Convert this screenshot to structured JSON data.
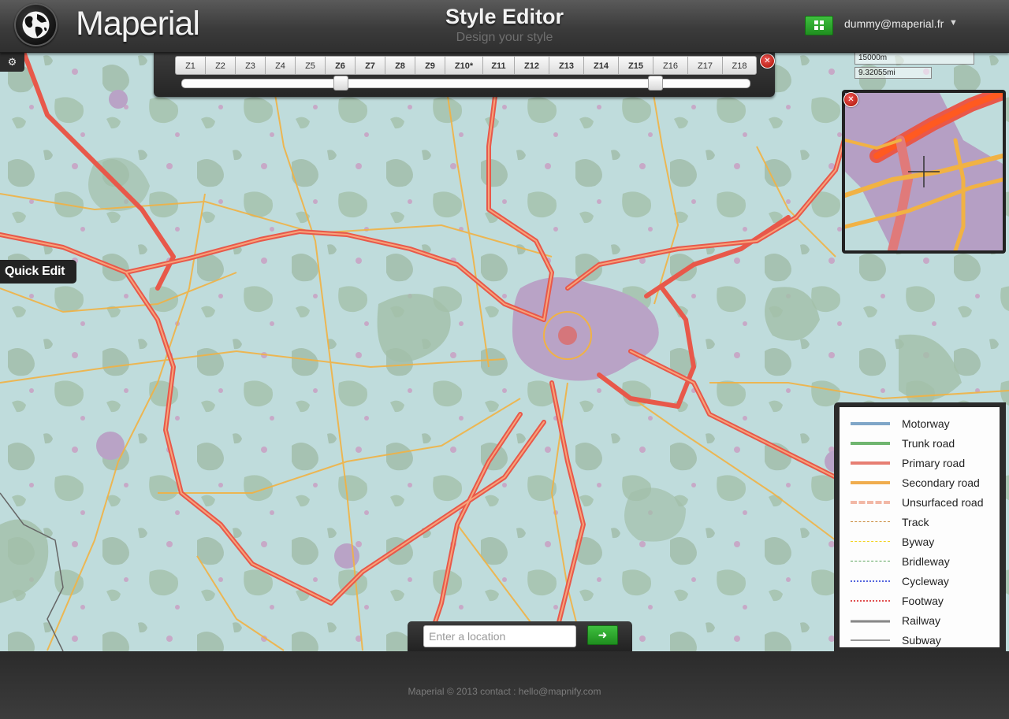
{
  "header": {
    "app_name": "Maperial",
    "title": "Style Editor",
    "subtitle": "Design your style",
    "user_email": "dummy@maperial.fr",
    "user_caret": "▼"
  },
  "zoom_toolbar": {
    "levels": [
      "Z1",
      "Z2",
      "Z3",
      "Z4",
      "Z5",
      "Z6",
      "Z7",
      "Z8",
      "Z9",
      "Z10*",
      "Z11",
      "Z12",
      "Z13",
      "Z14",
      "Z15",
      "Z16",
      "Z17",
      "Z18"
    ],
    "bold_levels": [
      "Z6",
      "Z7",
      "Z8",
      "Z9",
      "Z10*",
      "Z11",
      "Z12",
      "Z13",
      "Z14",
      "Z15"
    ],
    "range_start": "Z6",
    "range_end": "Z15"
  },
  "scale": {
    "metric": "15000m",
    "imperial": "9.32055mi"
  },
  "quick_edit_label": "Quick Edit",
  "legend": {
    "items": [
      {
        "label": "Motorway",
        "color": "#7fa6c8",
        "style": "solid"
      },
      {
        "label": "Trunk road",
        "color": "#6fb56f",
        "style": "solid"
      },
      {
        "label": "Primary road",
        "color": "#e77e72",
        "style": "solid"
      },
      {
        "label": "Secondary road",
        "color": "#f0ad4e",
        "style": "solid"
      },
      {
        "label": "Unsurfaced road",
        "color": "#f2b8a6",
        "style": "dashed-wide"
      },
      {
        "label": "Track",
        "color": "#c88a3c",
        "style": "dashed"
      },
      {
        "label": "Byway",
        "color": "#f3d21e",
        "style": "dashed"
      },
      {
        "label": "Bridleway",
        "color": "#5aa35a",
        "style": "dashed"
      },
      {
        "label": "Cycleway",
        "color": "#5566dd",
        "style": "dotted"
      },
      {
        "label": "Footway",
        "color": "#e05050",
        "style": "dotted"
      },
      {
        "label": "Railway",
        "color": "#888888",
        "style": "rail"
      },
      {
        "label": "Subway",
        "color": "#999999",
        "style": "solid-thin"
      }
    ]
  },
  "search": {
    "placeholder": "Enter a location",
    "value": "",
    "go_icon": "arrow-right-icon"
  },
  "footer": {
    "text": "Maperial © 2013 contact : hello@mapnify.com"
  },
  "colors": {
    "water_bg": "#bfdcdc",
    "forest": "#a7c4b0",
    "urban": "#b8a3c4",
    "primary_road": "#e8584a",
    "secondary_road": "#f1b244",
    "accent_green": "#2fa82f"
  },
  "icons": {
    "logo": "globe-icon",
    "settings": "gear-icon",
    "apps": "grid-icon",
    "close": "close-icon"
  }
}
